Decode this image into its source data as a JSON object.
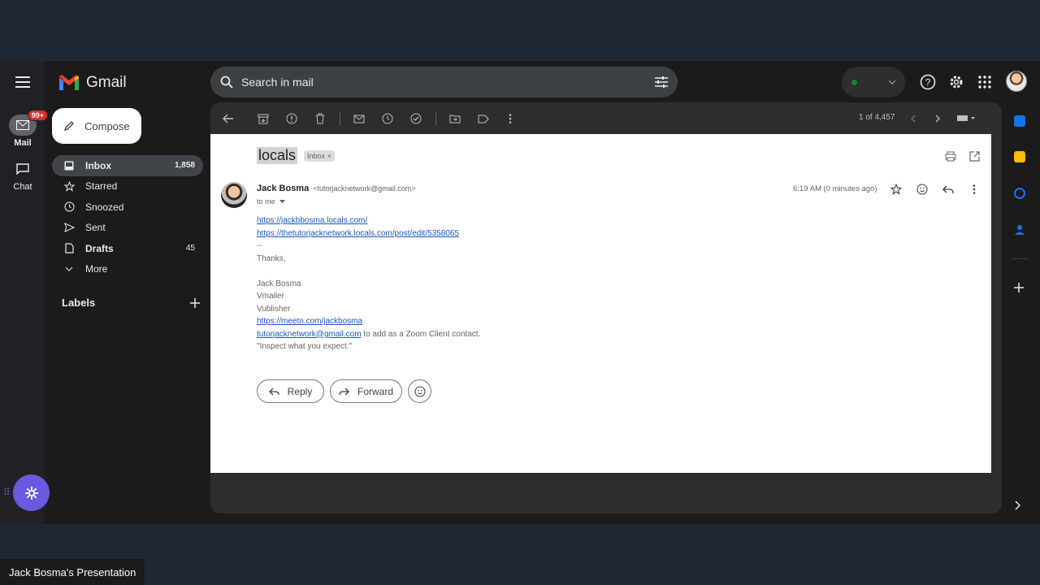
{
  "app": {
    "name": "Gmail"
  },
  "rail": {
    "mail_label": "Mail",
    "mail_badge": "99+",
    "chat_label": "Chat"
  },
  "search": {
    "placeholder": "Search in mail"
  },
  "compose": {
    "label": "Compose"
  },
  "nav": {
    "items": [
      {
        "label": "Inbox",
        "count": "1,858"
      },
      {
        "label": "Starred",
        "count": ""
      },
      {
        "label": "Snoozed",
        "count": ""
      },
      {
        "label": "Sent",
        "count": ""
      },
      {
        "label": "Drafts",
        "count": "45"
      },
      {
        "label": "More",
        "count": ""
      }
    ]
  },
  "labels": {
    "title": "Labels"
  },
  "toolbar": {
    "pager": "1 of 4,457"
  },
  "message": {
    "subject": "locals",
    "chip": "Inbox",
    "chip_close": "×",
    "sender_name": "Jack Bosma",
    "sender_email": "<tutorjacknetwork@gmail.com>",
    "to": "to me",
    "timestamp": "6:19 AM (0 minutes ago)",
    "link1": "https://jackbbosma.locals.com/",
    "link2": "https://thetutorjacknetwork.locals.com/post/edit/5358065",
    "sig_sep": "--",
    "thanks": "Thanks,",
    "sig_name": "Jack Bosma",
    "sig_line2": "Vmailer",
    "sig_line3": "Vublisher",
    "sig_link": "https://meetn.com/jackbosma",
    "sig_email": "tutorjacknetwork@gmail.com",
    "sig_email_suffix": " to add as a Zoom Client contact.",
    "quote": "\"Inspect what you expect.\""
  },
  "actions": {
    "reply": "Reply",
    "forward": "Forward"
  },
  "caption": "Jack Bosma's Presentation"
}
